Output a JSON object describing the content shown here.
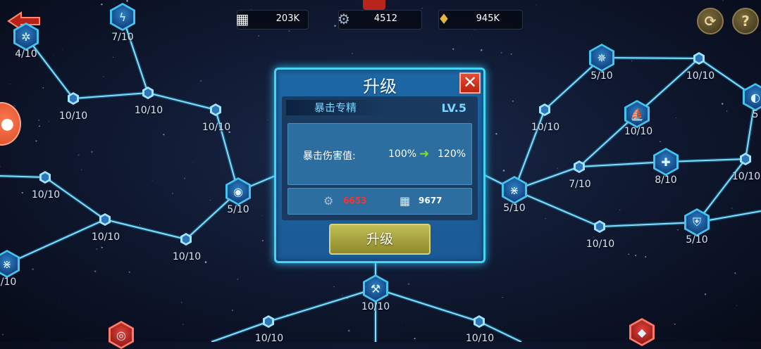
{
  "resources": {
    "crate": {
      "value": "203K",
      "icon": "crate-icon"
    },
    "part": {
      "value": "4512",
      "icon": "mechanical-part-icon"
    },
    "crystal": {
      "value": "945K",
      "icon": "crystal-icon"
    }
  },
  "buttons": {
    "back_icon": "back-arrow-icon",
    "refresh_glyph": "⟳",
    "help_glyph": "?"
  },
  "dialog": {
    "title": "升级",
    "close_glyph": "✕",
    "skill_name": "暴击专精",
    "level": "LV.5",
    "stat_label": "暴击伤害值:",
    "stat_from": "100%",
    "stat_arrow": "➜",
    "stat_to": "120%",
    "cost_part": "6653",
    "cost_crate": "9677",
    "upgrade_label": "升级"
  },
  "node_labels": {
    "n1": "4/10",
    "n2": "7/10",
    "n3": "10/10",
    "n4": "10/10",
    "n5": "10/10",
    "n6": "5/10",
    "n7": "10/10",
    "n8": "10/10",
    "n9": "10/10",
    "n10": "/10",
    "n11": "10/10",
    "n12": "10/10",
    "n13": "10/10",
    "n14": "5/10",
    "n15": "10/10",
    "n16": "5",
    "n17": "10/10",
    "n18": "10/10",
    "n19": "7/10",
    "n20": "8/10",
    "n21": "10/10",
    "n22": "5/10",
    "n23": "10/10",
    "n24": "5/10"
  }
}
